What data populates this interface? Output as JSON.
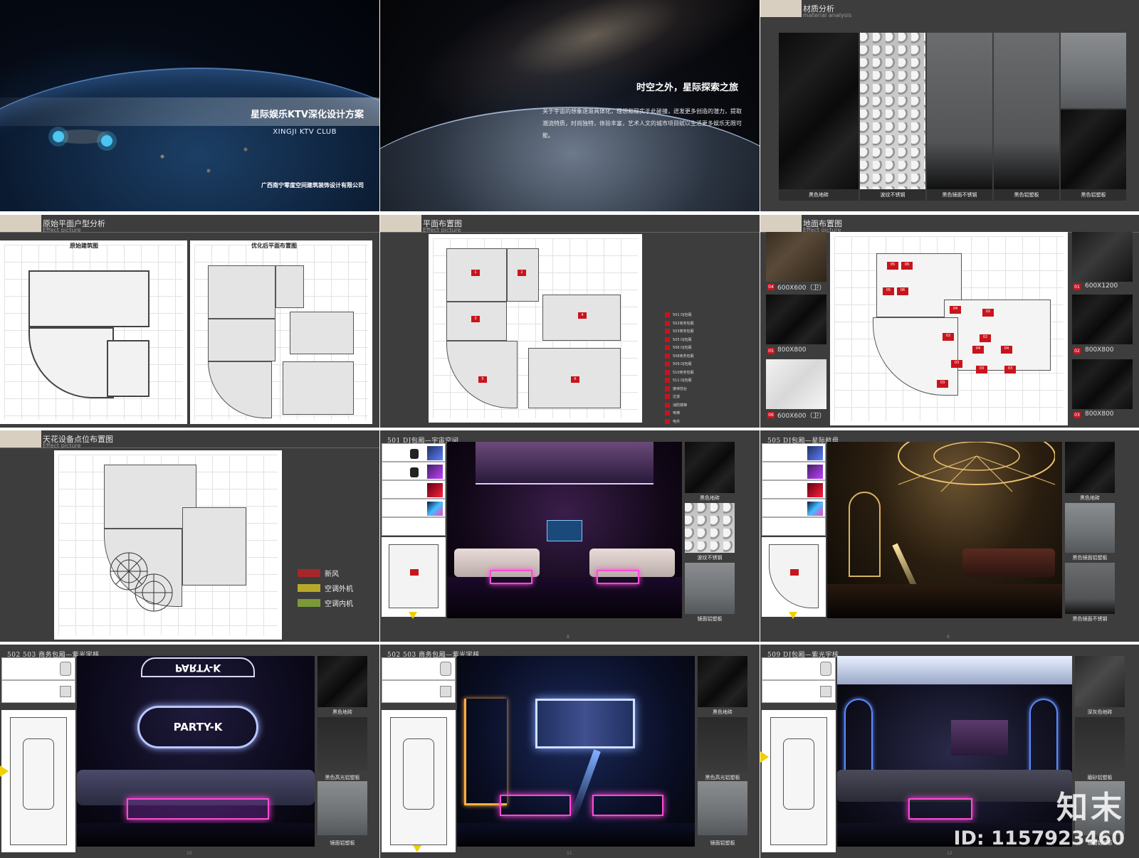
{
  "slide1": {
    "title": "星际娱乐KTV深化设计方案",
    "subtitle_en": "XINGJI KTV CLUB",
    "company": "广西南宁零度空间建筑装饰设计有限公司"
  },
  "slide2": {
    "title": "时空之外，星际探索之旅",
    "body": "关于宇宙的想象逐渐具体化，理想和现实于此碰撞，迸发更多创造的潜力，提取潮流特质，时尚独特，体验丰富，艺术人文的城市项目赋以生活更多娱乐无限可能。"
  },
  "slide3": {
    "title": "材质分析",
    "subtitle": "material analysis",
    "materials": [
      "黑色地砖",
      "波纹不锈钢",
      "黑色镜面不锈钢",
      "黑色铝塑板",
      "黑色铝塑板"
    ]
  },
  "slide4": {
    "title": "原始平面户型分析",
    "subtitle": "Effect picture",
    "left_caption": "原始建筑图",
    "right_caption": "优化后平面布置图"
  },
  "slide5": {
    "title": "平面布置图",
    "subtitle": "Effect picture",
    "legend": [
      {
        "num": "1",
        "text": "501 DJ包厢"
      },
      {
        "num": "2",
        "text": "502商务包厢"
      },
      {
        "num": "3",
        "text": "503商务包厢"
      },
      {
        "num": "4",
        "text": "505 DJ包厢"
      },
      {
        "num": "5",
        "text": "506 DJ包厢"
      },
      {
        "num": "6",
        "text": "508商务包厢"
      },
      {
        "num": "7",
        "text": "509 DJ包厢"
      },
      {
        "num": "8",
        "text": "510商务包厢"
      },
      {
        "num": "9",
        "text": "511 DJ包厢"
      },
      {
        "num": "10",
        "text": "接待前台"
      },
      {
        "num": "11",
        "text": "过道"
      },
      {
        "num": "12",
        "text": "消防楼梯"
      },
      {
        "num": "13",
        "text": "电梯"
      },
      {
        "num": "14",
        "text": "电井"
      }
    ]
  },
  "slide6": {
    "title": "地面布置图",
    "subtitle": "Effect picture",
    "tiles_left": [
      {
        "num": "04",
        "text": "600X600（卫）"
      },
      {
        "num": "05",
        "text": "800X800"
      },
      {
        "num": "06",
        "text": "600X600（卫）"
      }
    ],
    "tiles_right": [
      {
        "num": "01",
        "text": "600X1200"
      },
      {
        "num": "02",
        "text": "800X800"
      },
      {
        "num": "03",
        "text": "800X800"
      }
    ],
    "plan_tags": [
      "05",
      "06",
      "05",
      "06",
      "02",
      "04",
      "02",
      "02",
      "04",
      "03",
      "03",
      "03",
      "04",
      "03"
    ]
  },
  "slide7": {
    "title": "天花设备点位布置图",
    "subtitle": "Effect picture",
    "legend": [
      {
        "text": "新风",
        "color": "#a8262a"
      },
      {
        "text": "空调外机",
        "color": "#b8a82a"
      },
      {
        "text": "空调内机",
        "color": "#7a9a3a"
      }
    ]
  },
  "slide8": {
    "title": "501 DJ包厢—宇宙空间",
    "materials": [
      "黑色地砖",
      "波纹不锈钢",
      "镜面铝塑板"
    ],
    "page": "8"
  },
  "slide9": {
    "title": "505 DJ包厢—星际航母",
    "materials": [
      "黑色地砖",
      "黑色镜面铝塑板",
      "黑色镜面不锈钢"
    ],
    "page": "9"
  },
  "slide10": {
    "title": "502  503  商务包厢—紫光宇核",
    "sign": "PARTY-K",
    "sign_mirror": "PARTY-K",
    "materials": [
      "黑色地砖",
      "黑色高光铝塑板",
      "镜面铝塑板"
    ],
    "page": "10"
  },
  "slide11": {
    "title": "502  503  商务包厢—紫光宇核",
    "materials": [
      "黑色地砖",
      "黑色高光铝塑板",
      "镜面铝塑板"
    ],
    "page": "11"
  },
  "slide12": {
    "title": "509 DJ包厢—紫光宇核",
    "materials": [
      "深灰色地砖",
      "磨砂铝塑板",
      "镜面铝塑板"
    ],
    "page": "12"
  },
  "watermark": {
    "brand": "知末",
    "id": "ID: 1157923460"
  }
}
